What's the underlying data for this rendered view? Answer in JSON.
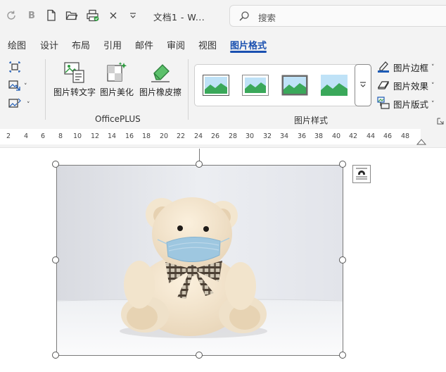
{
  "title_bar": {
    "document_title": "文档1  -  W...",
    "search_placeholder": "搜索",
    "icons": [
      "refresh-icon",
      "bold-icon",
      "new-file-icon",
      "open-folder-icon",
      "print-preview-icon",
      "close-icon",
      "dropdown-icon"
    ]
  },
  "tabs": [
    {
      "label": "绘图",
      "active": false
    },
    {
      "label": "设计",
      "active": false
    },
    {
      "label": "布局",
      "active": false
    },
    {
      "label": "引用",
      "active": false
    },
    {
      "label": "邮件",
      "active": false
    },
    {
      "label": "审阅",
      "active": false
    },
    {
      "label": "视图",
      "active": false
    },
    {
      "label": "图片格式",
      "active": true
    }
  ],
  "ribbon": {
    "officeplus": {
      "buttons": [
        {
          "label": "图片转文字",
          "icon": "image-to-text-icon"
        },
        {
          "label": "图片美化",
          "icon": "image-beautify-icon"
        },
        {
          "label": "图片橡皮擦",
          "icon": "image-eraser-icon"
        }
      ],
      "group_label": "OfficePLUS"
    },
    "picture_styles": {
      "group_label": "图片样式"
    },
    "right_tools": [
      {
        "label": "图片边框",
        "icon": "picture-border-icon"
      },
      {
        "label": "图片效果",
        "icon": "picture-effects-icon"
      },
      {
        "label": "图片版式",
        "icon": "picture-layout-icon"
      }
    ]
  },
  "ruler": {
    "ticks": [
      "2",
      "4",
      "6",
      "8",
      "10",
      "12",
      "14",
      "16",
      "18",
      "20",
      "22",
      "24",
      "26",
      "28",
      "30",
      "32",
      "34",
      "36",
      "38",
      "40",
      "42",
      "44",
      "46",
      "48"
    ]
  },
  "colors": {
    "accent": "#1a50b0",
    "ribbon_bg": "#f3f3f3"
  }
}
